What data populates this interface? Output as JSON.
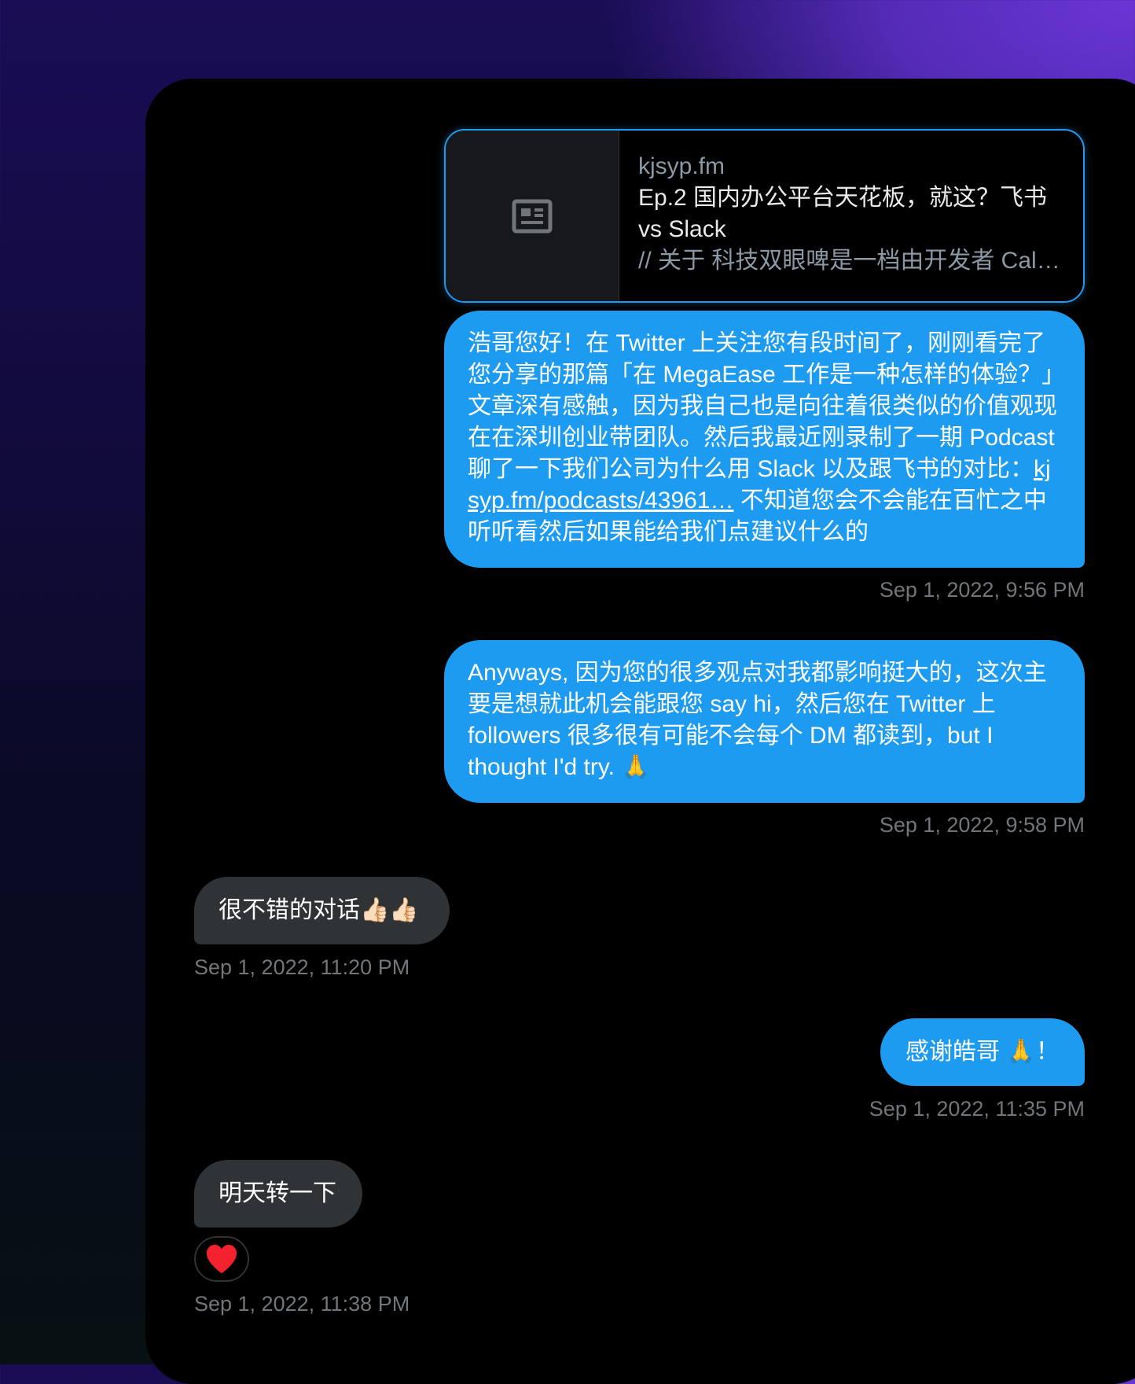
{
  "link_card": {
    "domain": "kjsyp.fm",
    "title": "Ep.2 国内办公平台天花板，就这？飞书 vs Slack",
    "description": "// 关于 科技双眼啤是一档由开发者 Calixto 和 ...",
    "thumbnail_icon": "article-icon"
  },
  "messages": [
    {
      "direction": "outgoing",
      "text_before_link": "浩哥您好！在 Twitter 上关注您有段时间了，刚刚看完了您分享的那篇「在 MegaEase 工作是一种怎样的体验？」文章深有感触，因为我自己也是向往着很类似的价值观现在在深圳创业带团队。然后我最近刚录制了一期 Podcast 聊了一下我们公司为什么用 Slack 以及跟飞书的对比：",
      "link_text": "kjsyp.fm/podcasts/43961…",
      "text_after_link": " 不知道您会不会能在百忙之中听听看然后如果能给我们点建议什么的",
      "timestamp": "Sep 1, 2022, 9:56 PM"
    },
    {
      "direction": "outgoing",
      "text": "Anyways, 因为您的很多观点对我都影响挺大的，这次主要是想就此机会能跟您 say hi，然后您在 Twitter 上 followers 很多很有可能不会每个 DM 都读到，but I thought I'd try. 🙏",
      "timestamp": "Sep 1, 2022, 9:58 PM"
    },
    {
      "direction": "incoming",
      "text": "很不错的对话👍🏻👍🏻",
      "timestamp": "Sep 1, 2022, 11:20 PM"
    },
    {
      "direction": "outgoing",
      "text": "感谢皓哥 🙏！",
      "timestamp": "Sep 1, 2022, 11:35 PM"
    },
    {
      "direction": "incoming",
      "text": "明天转一下",
      "reaction": "❤️",
      "timestamp": "Sep 1, 2022, 11:38 PM"
    }
  ],
  "colors": {
    "outgoing_bubble": "#1d9bf0",
    "incoming_bubble": "#2f3336",
    "timestamp": "#71767b",
    "panel_background": "#000000",
    "heart": "#f91880"
  }
}
